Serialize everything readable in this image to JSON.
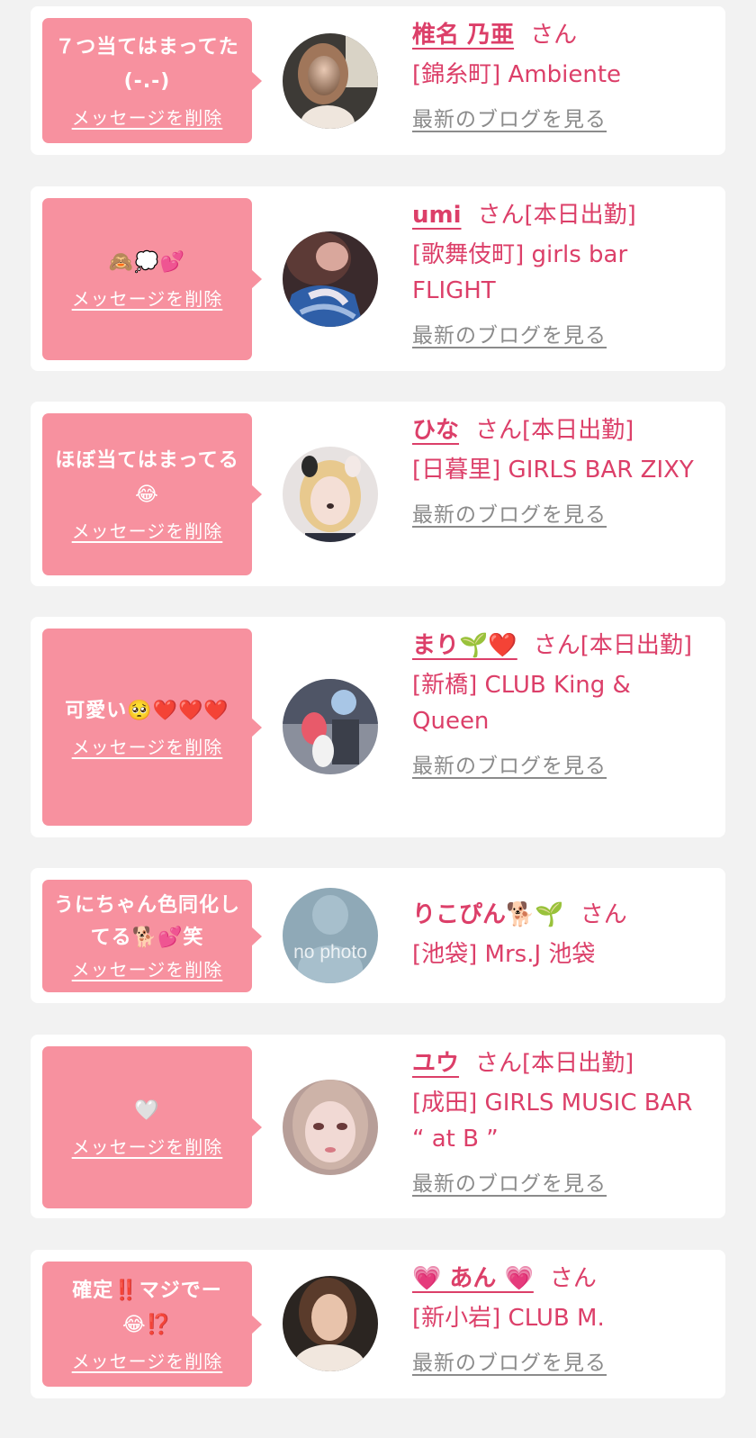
{
  "labels": {
    "delete_message": "メッセージを削除",
    "latest_blog": "最新のブログを見る"
  },
  "colors": {
    "background": "#f2f2f2",
    "card": "#ffffff",
    "bubble": "#f7919f",
    "accent_text": "#dc3f69",
    "link_gray": "#8b8b8b"
  },
  "messages": [
    {
      "comment": "７つ当てはまってた(-.-)",
      "name": "椎名 乃亜",
      "honorific": "さん",
      "status": "",
      "shop": "[錦糸町] Ambiente",
      "show_blog_link": true,
      "avatar_icon": "profile-photo-icon"
    },
    {
      "comment": "🙈💭💕",
      "name": "umi",
      "honorific": "さん",
      "status": "[本日出勤]",
      "shop": "[歌舞伎町] girls bar FLIGHT",
      "show_blog_link": true,
      "avatar_icon": "profile-photo-icon"
    },
    {
      "comment": "ほぼ当てはまってる😂",
      "name": "ひな",
      "honorific": "さん",
      "status": "[本日出勤]",
      "shop": "[日暮里] GIRLS BAR ZIXY",
      "show_blog_link": true,
      "avatar_icon": "profile-photo-icon"
    },
    {
      "comment": "可愛い🥺❤️❤️❤️",
      "name": "まり🌱❤️",
      "honorific": "さん",
      "status": "[本日出勤]",
      "shop": "[新橋] CLUB King & Queen",
      "show_blog_link": true,
      "avatar_icon": "profile-photo-icon"
    },
    {
      "comment": "うにちゃん色同化してる🐕💕笑",
      "name": "りこぴん🐕🌱",
      "honorific": "さん",
      "status": "",
      "shop": "[池袋] Mrs.J 池袋",
      "show_blog_link": false,
      "avatar_icon": "no-photo-placeholder-icon",
      "avatar_placeholder_text": "no photo"
    },
    {
      "comment": "🤍",
      "name": "ユウ",
      "honorific": "さん",
      "status": "[本日出勤]",
      "shop": "[成田] GIRLS MUSIC BAR “ at B ”",
      "show_blog_link": true,
      "avatar_icon": "profile-photo-icon"
    },
    {
      "comment": "確定‼️マジでー😂⁉️",
      "name": "💗 あん 💗",
      "honorific": "さん",
      "status": "",
      "shop": "[新小岩] CLUB M.",
      "show_blog_link": true,
      "avatar_icon": "profile-photo-icon"
    }
  ]
}
